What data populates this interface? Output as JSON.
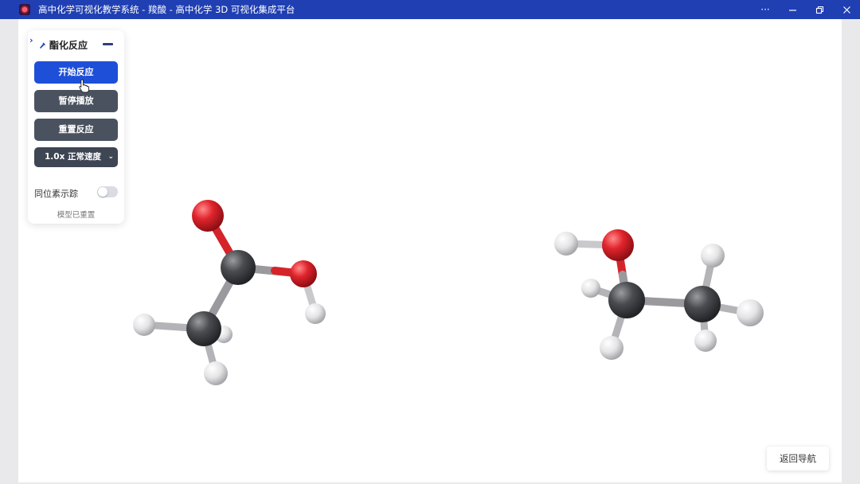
{
  "window": {
    "title": "高中化学可视化教学系统 - 羧酸 - 高中化学 3D 可视化集成平台",
    "controls": {
      "more": "···"
    }
  },
  "panel": {
    "title": "酯化反应",
    "start_label": "开始反应",
    "pause_label": "暂停播放",
    "reset_label": "重置反应",
    "speed_selected": "1.0x 正常速度",
    "isotope_label": "同位素示踪",
    "isotope_enabled": false,
    "status": "模型已重置"
  },
  "return_button": "返回导航",
  "colors": {
    "titlebar": "#1f3fb3",
    "primary": "#1e4fd8",
    "secondary": "#4a5260",
    "oxygen": "#e0242c",
    "carbon": "#4a4c50",
    "hydrogen": "#e4e4e6"
  },
  "molecules": [
    {
      "name": "acetic-acid",
      "atoms": [
        "O",
        "C",
        "O",
        "H",
        "C",
        "H",
        "H",
        "H"
      ]
    },
    {
      "name": "ethanol",
      "atoms": [
        "H",
        "O",
        "C",
        "C",
        "H",
        "H",
        "H",
        "H",
        "H"
      ]
    }
  ]
}
